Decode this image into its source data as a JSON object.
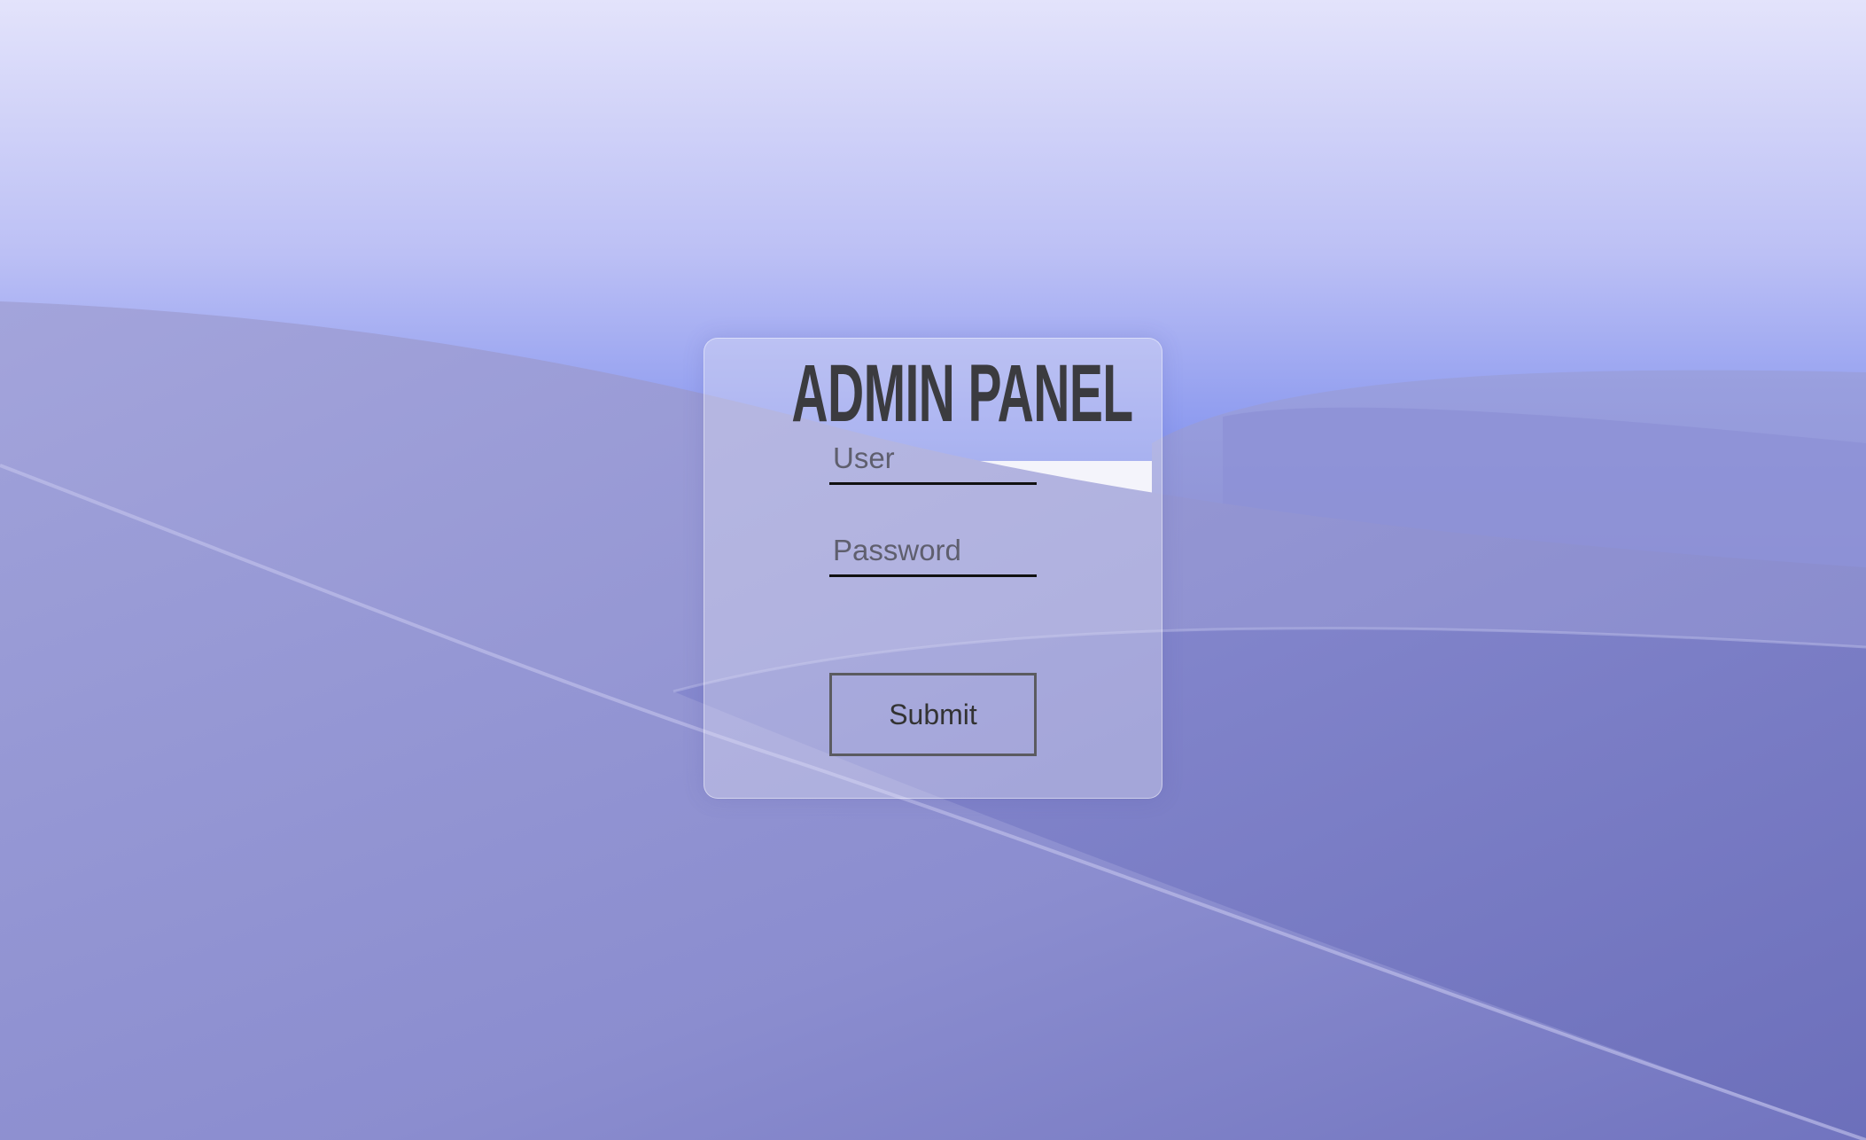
{
  "login": {
    "title": "ADMIN PANEL",
    "user_placeholder": "User",
    "user_value": "",
    "password_placeholder": "Password",
    "password_value": "",
    "submit_label": "Submit"
  },
  "colors": {
    "sky_top": "#e3e3fb",
    "sky_horizon": "#8594ee",
    "dune_main": "#8f91d0",
    "dune_shadow": "#6f72bf",
    "title_text": "#3b3b3f"
  }
}
